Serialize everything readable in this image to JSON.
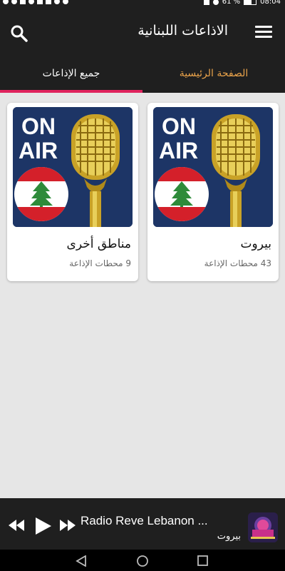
{
  "status_bar": {
    "battery_text": "61 %",
    "time": "08:04"
  },
  "app_bar": {
    "title": "الاذاعات اللبنانية",
    "menu_icon": "menu-icon",
    "search_icon": "search-icon"
  },
  "tabs": {
    "home": {
      "label": "الصفحة الرئيسية"
    },
    "all": {
      "label": "جميع الإذاعات"
    },
    "selected": "all"
  },
  "cards": [
    {
      "title": "بيروت",
      "subtitle": "43 محطات الإذاعة",
      "image_text_top": "ON",
      "image_text_bottom": "AIR"
    },
    {
      "title": "مناطق أخرى",
      "subtitle": "9 محطات الإذاعة",
      "image_text_top": "ON",
      "image_text_bottom": "AIR"
    }
  ],
  "player": {
    "station_name": "Radio Reve Lebanon ...",
    "location": "بيروت",
    "icons": [
      "rewind-icon",
      "play-icon",
      "fast-forward-icon"
    ]
  },
  "colors": {
    "bar_background": "#1f1f1f",
    "accent_tab_text": "#e9a24a",
    "tab_indicator": "#e0245e",
    "content_background": "#e6e6e6"
  }
}
